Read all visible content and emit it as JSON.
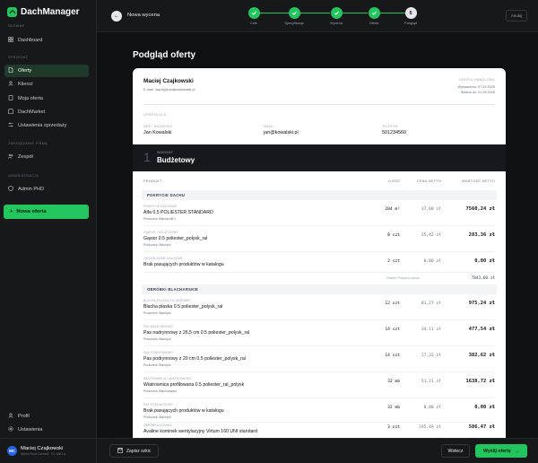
{
  "app": {
    "name": "DachManager"
  },
  "sidebar": {
    "sections": {
      "main": "GŁÓWNE",
      "sales": "SPRZEDAŻ",
      "company": "ZARZĄDZANIE FIRMĄ",
      "admin": "ADMINISTRACJA"
    },
    "items": [
      {
        "label": "Dashboard",
        "icon": "grid-icon"
      },
      {
        "label": "Oferty",
        "icon": "document-icon",
        "active": true
      },
      {
        "label": "Klienci",
        "icon": "users-icon"
      },
      {
        "label": "Moja oferta",
        "icon": "file-icon"
      },
      {
        "label": "DachMarket",
        "icon": "store-icon"
      },
      {
        "label": "Ustawienia sprzedaży",
        "icon": "sliders-icon"
      },
      {
        "label": "Zespół",
        "icon": "team-icon"
      },
      {
        "label": "Admin PHD",
        "icon": "shield-icon"
      }
    ],
    "new_offer": "Nowa oferta",
    "bottom": [
      {
        "label": "Profil",
        "icon": "user-icon"
      },
      {
        "label": "Ustawienia",
        "icon": "gear-icon"
      }
    ],
    "user": {
      "initials": "MC",
      "name": "Maciej Czajkowski",
      "role": "Admin Roof Connect · ID: 4881 ▸"
    }
  },
  "topbar": {
    "back_icon": "arrow-left-icon",
    "title": "Nowa wycena",
    "steps": [
      {
        "label": "Cele",
        "done": true
      },
      {
        "label": "Specyfikacja",
        "done": true
      },
      {
        "label": "Wycena",
        "done": true
      },
      {
        "label": "Oferta",
        "done": true
      },
      {
        "label": "Podgląd",
        "number": "5",
        "current": true
      }
    ],
    "cancel": "Anuluj"
  },
  "main": {
    "title": "Podgląd oferty",
    "doc": {
      "seller_name": "Maciej Czajkowski",
      "seller_email": "E-mail: maciej@czajkowskiwiak.pl",
      "offer_label": "OFERTA HANDLOWA",
      "issued": "Wystawiono: 07.09.2025",
      "valid": "Ważna do: 21.09.2025",
      "for_label": "OFERTA DLA:",
      "client_cols": [
        {
          "label": "IMIĘ I NAZWISKO",
          "value": "Jan Kowalski"
        },
        {
          "label": "EMAIL",
          "value": "jan@kowalski.pl"
        },
        {
          "label": "TELEFON",
          "value": "501234560"
        }
      ],
      "variant": {
        "number": "1",
        "label": "WARIANT",
        "name": "Budżetowy"
      },
      "table_headers": {
        "product": "PRODUKT",
        "qty": "ILOŚĆ",
        "net_price": "CENA NETTO",
        "net_value": "WARTOŚĆ NETTO"
      },
      "groups": [
        {
          "name": "POKRYCIE DACHU",
          "items": [
            {
              "category": "POKRYCIE DACHOWE",
              "name": "Alfa 0,5 POLIESTER STANDARD",
              "producer": "Producent: Blachprofil 2",
              "qty": "204 m²",
              "price": "37,08 zł",
              "value": "7560,24 zł"
            },
            {
              "category": "GĄSIOR I SZCZYTOWY",
              "name": "Gąsior 0.5 poliester_polysk_ral",
              "producer": "Producent: Blachpol",
              "qty": "8 szt",
              "price": "35,42 zł",
              "value": "283,36 zł"
            },
            {
              "category": "ZAKOŃCZENIE DACHOWE",
              "name": "Brak pasujących produktów w katalogu",
              "producer": "",
              "qty": "2 szt",
              "price": "0,00 zł",
              "value": "0,00 zł"
            }
          ],
          "subtotal_label": "Razem Pokrycie dachu",
          "subtotal_value": "7843,60 zł"
        },
        {
          "name": "OBRÓBKI BLACHARSKIE",
          "items": [
            {
              "category": "BLACHA PŁASKA DO OBRÓBEK",
              "name": "Blacha płaska 0.5 poliester_polysk_ral",
              "producer": "Producent: Blachpol",
              "qty": "12 szt",
              "price": "81,27 zł",
              "value": "975,24 zł"
            },
            {
              "category": "PAS NADRYNNOWY",
              "name": "Pas nadrynnowy z 26,5 cm 0.5 poliester_polysk_ral",
              "producer": "Producent: Blachpol",
              "qty": "14 szt",
              "price": "34,11 zł",
              "value": "477,54 zł"
            },
            {
              "category": "PAS PODRYNNOWY",
              "name": "Pas podrynnowy z 20 cm 0.5 poliester_polysk_ral",
              "producer": "Producent: Blachpol",
              "qty": "14 szt",
              "price": "27,33 zł",
              "value": "382,62 zł"
            },
            {
              "category": "WIATROWNICA / WIATROWNICE",
              "name": "Wiatrownica profilowana 0.5 poliester_ral_polysk",
              "producer": "Producent: Blachotrapez",
              "qty": "32 mb",
              "price": "51,21 zł",
              "value": "1638,72 zł"
            },
            {
              "category": "PAS PODDACHOWY",
              "name": "Brak pasujących produktów w katalogu",
              "producer": "Producent: Blachpol",
              "qty": "32 mb",
              "price": "0,00 zł",
              "value": "0,00 zł"
            },
            {
              "category": "OBRÓBKA KOMINA",
              "name": "Avaline kominek wentylacyjny Virtum 160 UNI standard",
              "producer": "Producent: Blachotrapez",
              "qty": "3 szt",
              "price": "195,49 zł",
              "value": "586,47 zł"
            }
          ]
        }
      ]
    }
  },
  "bottombar": {
    "save_draft": "Zapisz szkic",
    "back": "Wstecz",
    "send": "Wyślij ofertę"
  }
}
